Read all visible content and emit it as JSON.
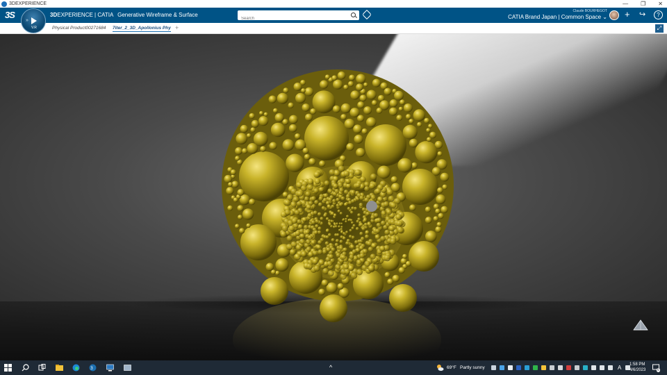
{
  "window": {
    "title": "3DEXPERIENCE",
    "minimize": "—",
    "restore": "❐",
    "close": "✕"
  },
  "header": {
    "logo": "3S",
    "brand_prefix": "3D",
    "brand_main": "EXPERIENCE | CATIA",
    "app_name": "Generative Wireframe & Surface",
    "compass_version": "V.R",
    "search_placeholder": "Search",
    "user_name": "Claude BOURHEGOT",
    "space": "CATIA Brand Japan | Common Space",
    "space_chevron": "⌄",
    "add": "+",
    "share": "↪",
    "help": "?",
    "colors": {
      "header_bg": "#005386",
      "accent": "#1b6fb0"
    }
  },
  "tabs": [
    {
      "label": "Physical Product00271684",
      "active": false
    },
    {
      "label": "7iter_2_3D_Apollonius Phy",
      "active": true
    }
  ],
  "tab_add": "+",
  "expand": "⤢",
  "model": {
    "color": "#b8a41e",
    "highlight": "#f2e27a",
    "shadow": "#5a4e08"
  },
  "taskbar": {
    "weather_temp": "69°F",
    "weather_text": "Partly sunny",
    "time": "1:58 PM",
    "date": "4/6/2023",
    "notification_count": "6",
    "ime": "A",
    "up_arrow": "^"
  }
}
